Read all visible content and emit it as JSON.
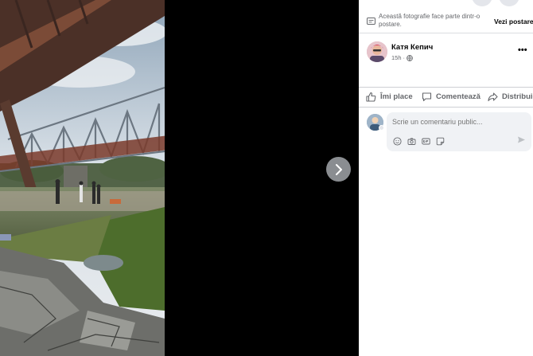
{
  "viewer": {
    "photo_alt": "",
    "next_icon": "chevron-right-icon"
  },
  "panel": {
    "album_note": {
      "icon": "album-icon",
      "text": "Această fotografie face parte dintr-o postare.",
      "link": "Vezi postarea"
    },
    "author": {
      "name": "Катя Кепич",
      "time": "15h",
      "privacy_icon": "globe-icon",
      "more_label": "•••"
    },
    "actions": [
      {
        "label": "Îmi place",
        "icon": "like-icon"
      },
      {
        "label": "Comentează",
        "icon": "comment-icon"
      },
      {
        "label": "Distribuie",
        "icon": "share-icon"
      }
    ],
    "comment": {
      "placeholder": "Scrie un comentariu public...",
      "tools": [
        "emoji-icon",
        "camera-icon",
        "gif-icon",
        "sticker-icon"
      ],
      "send_icon": "send-icon"
    }
  },
  "colors": {
    "panel_bg": "#ffffff",
    "viewer_bg": "#000000",
    "muted_text": "#65676b",
    "primary_text": "#050505",
    "input_bg": "#f0f2f5"
  }
}
